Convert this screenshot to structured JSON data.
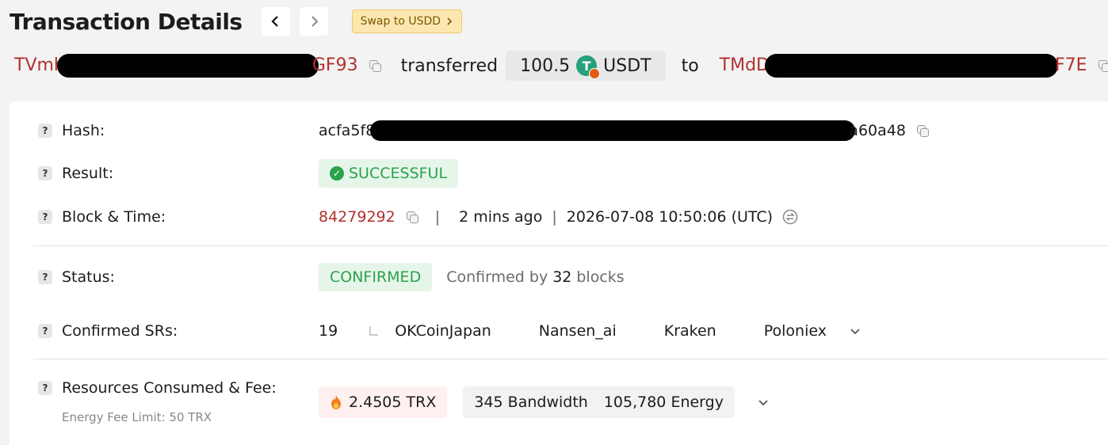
{
  "header": {
    "title": "Transaction Details",
    "swap_label": "Swap to USDD"
  },
  "transfer": {
    "from_start": "TVmh",
    "from_end": "GF93",
    "verb": "transferred",
    "amount": "100.5",
    "token_symbol": "USDT",
    "to_word": "to",
    "to_start": "TMdD",
    "to_end": "F7E"
  },
  "details": {
    "hash": {
      "label": "Hash:",
      "start": "acfa5f8",
      "end": "a60a48"
    },
    "result": {
      "label": "Result:",
      "value": "SUCCESSFUL"
    },
    "block_time": {
      "label": "Block & Time:",
      "block": "84279292",
      "ago": "2 mins ago",
      "time": "2026-07-08 10:50:06 (UTC)"
    },
    "status": {
      "label": "Status:",
      "value": "CONFIRMED",
      "confirmed_by": "Confirmed by",
      "blocks_count": "32",
      "blocks_word": "blocks"
    },
    "srs": {
      "label": "Confirmed SRs:",
      "count": "19",
      "items": [
        "OKCoinJapan",
        "Nansen_ai",
        "Kraken",
        "Poloniex"
      ]
    },
    "resources": {
      "label": "Resources Consumed & Fee:",
      "fee_limit": "Energy Fee Limit: 50 TRX",
      "fee": "2.4505 TRX",
      "bandwidth": "345 Bandwidth",
      "energy": "105,780 Energy"
    }
  }
}
